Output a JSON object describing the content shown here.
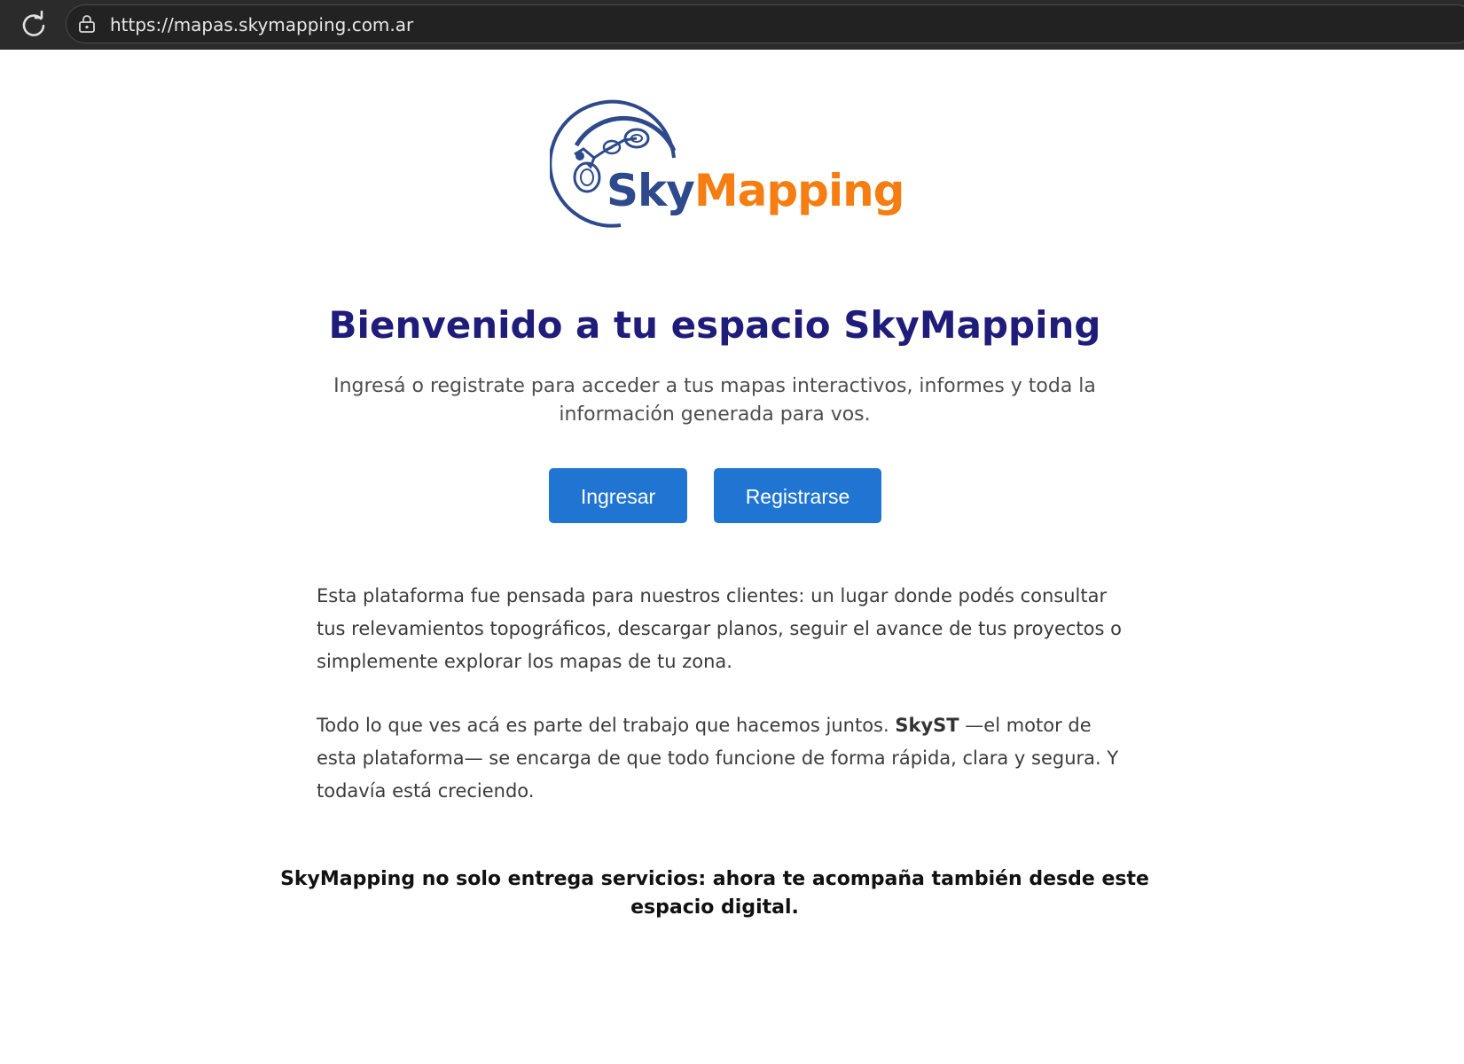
{
  "browser": {
    "url": "https://mapas.skymapping.com.ar"
  },
  "logo": {
    "name_part1": "Sky",
    "name_part2": "Mapping",
    "color_primary": "#2e4a8c",
    "color_accent": "#f57d11"
  },
  "hero": {
    "title": "Bienvenido a tu espacio SkyMapping",
    "subtitle": "Ingresá o registrate para acceder a tus mapas interactivos, informes y toda la información generada para vos."
  },
  "actions": {
    "login_label": "Ingresar",
    "register_label": "Registrarse",
    "button_color": "#1f75d1"
  },
  "body": {
    "paragraph1": "Esta plataforma fue pensada para nuestros clientes: un lugar donde podés consultar tus relevamientos topográficos, descargar planos, seguir el avance de tus proyectos o simplemente explorar los mapas de tu zona.",
    "paragraph2_before": "Todo lo que ves acá es parte del trabajo que hacemos juntos. ",
    "paragraph2_bold": "SkyST",
    "paragraph2_after": " —el motor de esta plataforma— se encarga de que todo funcione de forma rápida, clara y segura. Y todavía está creciendo."
  },
  "closing": "SkyMapping no solo entrega servicios: ahora te acompaña también desde este espacio digital."
}
